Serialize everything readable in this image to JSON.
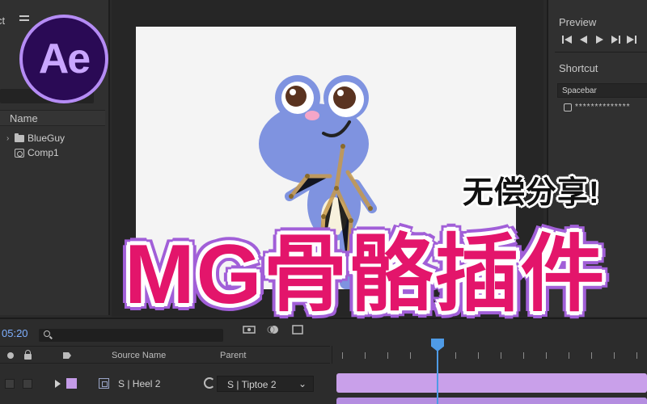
{
  "project": {
    "tab_label": "ct",
    "menu_icon": "hamburger-menu-icon",
    "column_name": "Name",
    "items": [
      {
        "label": "BlueGuy",
        "icon": "folder-icon"
      },
      {
        "label": "Comp1",
        "icon": "composition-icon"
      }
    ]
  },
  "app_logo": "Ae",
  "preview": {
    "title": "Preview",
    "controls": [
      "first-frame-icon",
      "previous-frame-icon",
      "play-icon",
      "next-frame-icon",
      "last-frame-icon"
    ]
  },
  "shortcut": {
    "title": "Shortcut",
    "selected": "Spacebar",
    "masked_value": "**************"
  },
  "timeline": {
    "timecode": "05:20",
    "columns": {
      "source_name": "Source Name",
      "parent": "Parent"
    },
    "layer": {
      "name": "S | Heel 2",
      "parent": "S | Tiptoe 2"
    }
  },
  "overlay": {
    "subtitle": "无偿分享!",
    "title": "MG骨骼插件"
  },
  "colors": {
    "accent_blue": "#4f9be6",
    "layer_label": "#c49be8",
    "title_pink": "#e3156b",
    "title_outline": "#a15fd8",
    "ae_purple": "#b58cf5"
  }
}
